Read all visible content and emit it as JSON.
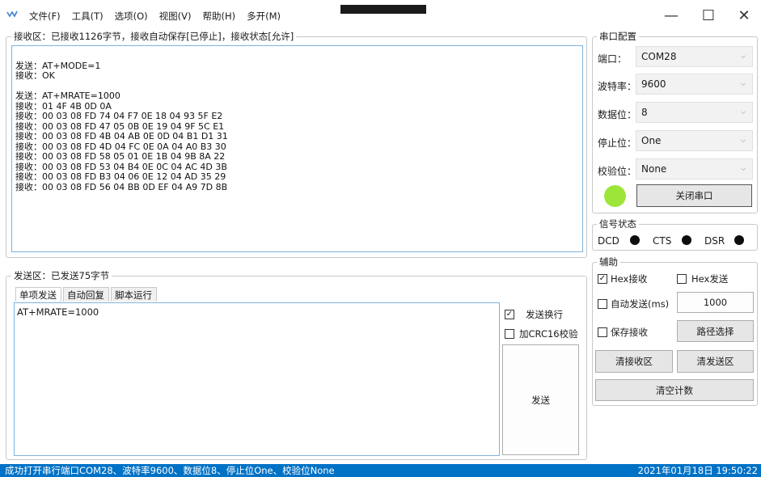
{
  "menu": {
    "items": [
      "文件(F)",
      "工具(T)",
      "选项(O)",
      "视图(V)",
      "帮助(H)",
      "多开(M)"
    ]
  },
  "window": {
    "minimize": "—",
    "maximize": "☐",
    "close": "✕"
  },
  "receive": {
    "title": "接收区：已接收1126字节，接收自动保存[已停止]，接收状态[允许]",
    "lines": [
      "",
      "发送：AT+MODE=1",
      "接收：OK",
      "",
      "发送：AT+MRATE=1000",
      "接收：01 4F 4B 0D 0A",
      "接收：00 03 08 FD 74 04 F7 0E 18 04 93 5F E2",
      "接收：00 03 08 FD 47 05 0B 0E 19 04 9F 5C E1",
      "接收：00 03 08 FD 4B 04 AB 0E 0D 04 B1 D1 31",
      "接收：00 03 08 FD 4D 04 FC 0E 0A 04 A0 B3 30",
      "接收：00 03 08 FD 58 05 01 0E 1B 04 9B 8A 22",
      "接收：00 03 08 FD 53 04 B4 0E 0C 04 AC 4D 3B",
      "接收：00 03 08 FD B3 04 06 0E 12 04 AD 35 29",
      "接收：00 03 08 FD 56 04 BB 0D EF 04 A9 7D 8B"
    ]
  },
  "send": {
    "title": "发送区：已发送75字节",
    "tabs": [
      "单项发送",
      "自动回复",
      "脚本运行"
    ],
    "input_value": "AT+MRATE=1000",
    "newline_label": "发送换行",
    "crc_label": "加CRC16校验",
    "send_button": "发送"
  },
  "serial": {
    "title": "串口配置",
    "port_label": "端口：",
    "port_value": "COM28",
    "baud_label": "波特率：",
    "baud_value": "9600",
    "data_label": "数据位：",
    "data_value": "8",
    "stop_label": "停止位：",
    "stop_value": "One",
    "parity_label": "校验位：",
    "parity_value": "None",
    "close_button": "关闭串口",
    "indicator_color": "#9ee53a"
  },
  "signal": {
    "title": "信号状态",
    "dcd": "DCD",
    "cts": "CTS",
    "dsr": "DSR"
  },
  "aux": {
    "title": "辅助",
    "hex_recv": "Hex接收",
    "hex_send": "Hex发送",
    "auto_send": "自动发送(ms)",
    "auto_interval": "1000",
    "save_recv": "保存接收",
    "path_button": "路径选择",
    "clear_recv": "清接收区",
    "clear_send": "清发送区",
    "clear_count": "清空计数"
  },
  "status": {
    "message": "成功打开串行端口COM28、波特率9600、数据位8、停止位One、校验位None",
    "datetime": "2021年01月18日 19:50:22"
  },
  "colors": {
    "accent": "#0072c6",
    "textbox_border": "#7fb2dc"
  }
}
